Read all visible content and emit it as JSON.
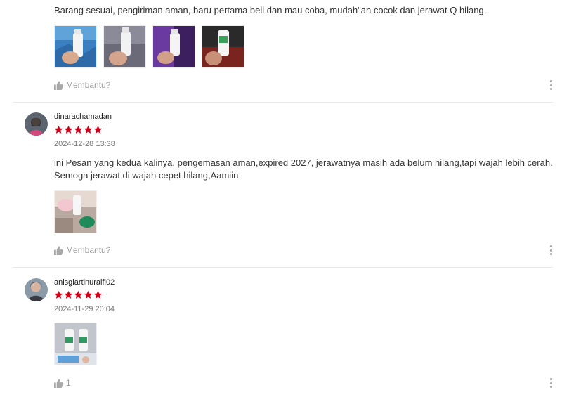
{
  "reviews": [
    {
      "comment": "Barang sesuai, pengiriman aman, baru pertama beli dan mau coba, mudah\"an cocok dan jerawat Q hilang.",
      "helpful_label": "Membantu?",
      "images": [
        "product-photo-1",
        "product-photo-2",
        "product-photo-3",
        "product-photo-4"
      ]
    },
    {
      "username": "dinarachamadan",
      "rating": 5,
      "date": "2024-12-28 13:38",
      "comment_line1": "ini Pesan yang kedua kalinya, pengemasan aman,expired 2027, jerawatnya masih ada belum hilang,tapi wajah lebih cerah.",
      "comment_line2": "Semoga jerawat di wajah cepet hilang,Aamiin",
      "helpful_label": "Membantu?",
      "images": [
        "product-photo-1"
      ]
    },
    {
      "username": "anisgiartinuralfi02",
      "rating": 5,
      "date": "2024-11-29 20:04",
      "helpful_count": "1",
      "images": [
        "product-photo-1"
      ]
    }
  ],
  "colors": {
    "star": "#d0011b",
    "muted": "#9a9a9a",
    "divider": "#e8e8e8"
  },
  "icons": {
    "like": "thumbs-up-icon",
    "more": "more-vertical-icon",
    "star": "star-icon"
  }
}
